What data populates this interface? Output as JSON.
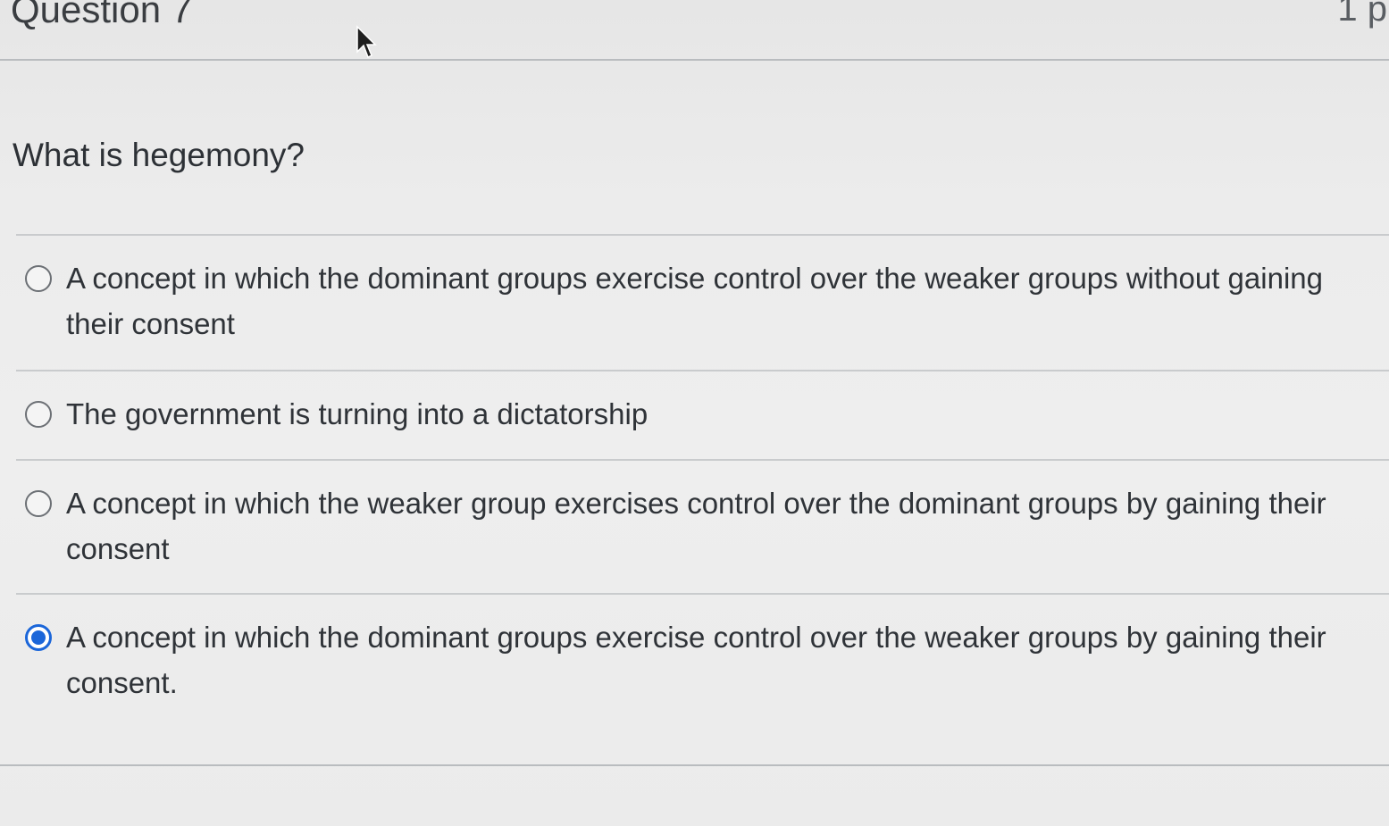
{
  "question": {
    "title": "Question 7",
    "points": "1 p",
    "prompt": "What is hegemony?"
  },
  "answers": [
    {
      "text": "A concept in which the dominant groups exercise control over the weaker groups without gaining their consent",
      "selected": false
    },
    {
      "text": "The government is turning into a dictatorship",
      "selected": false
    },
    {
      "text": "A concept in which the weaker group exercises control over the dominant groups by gaining their consent",
      "selected": false
    },
    {
      "text": "A concept in which the dominant groups exercise control over the weaker groups by gaining their consent.",
      "selected": true
    }
  ],
  "colors": {
    "radio_selected": "#1b66d9",
    "text": "#2f3338",
    "divider": "#c9cbcd"
  },
  "icons": {
    "cursor": "mouse-pointer-icon"
  }
}
